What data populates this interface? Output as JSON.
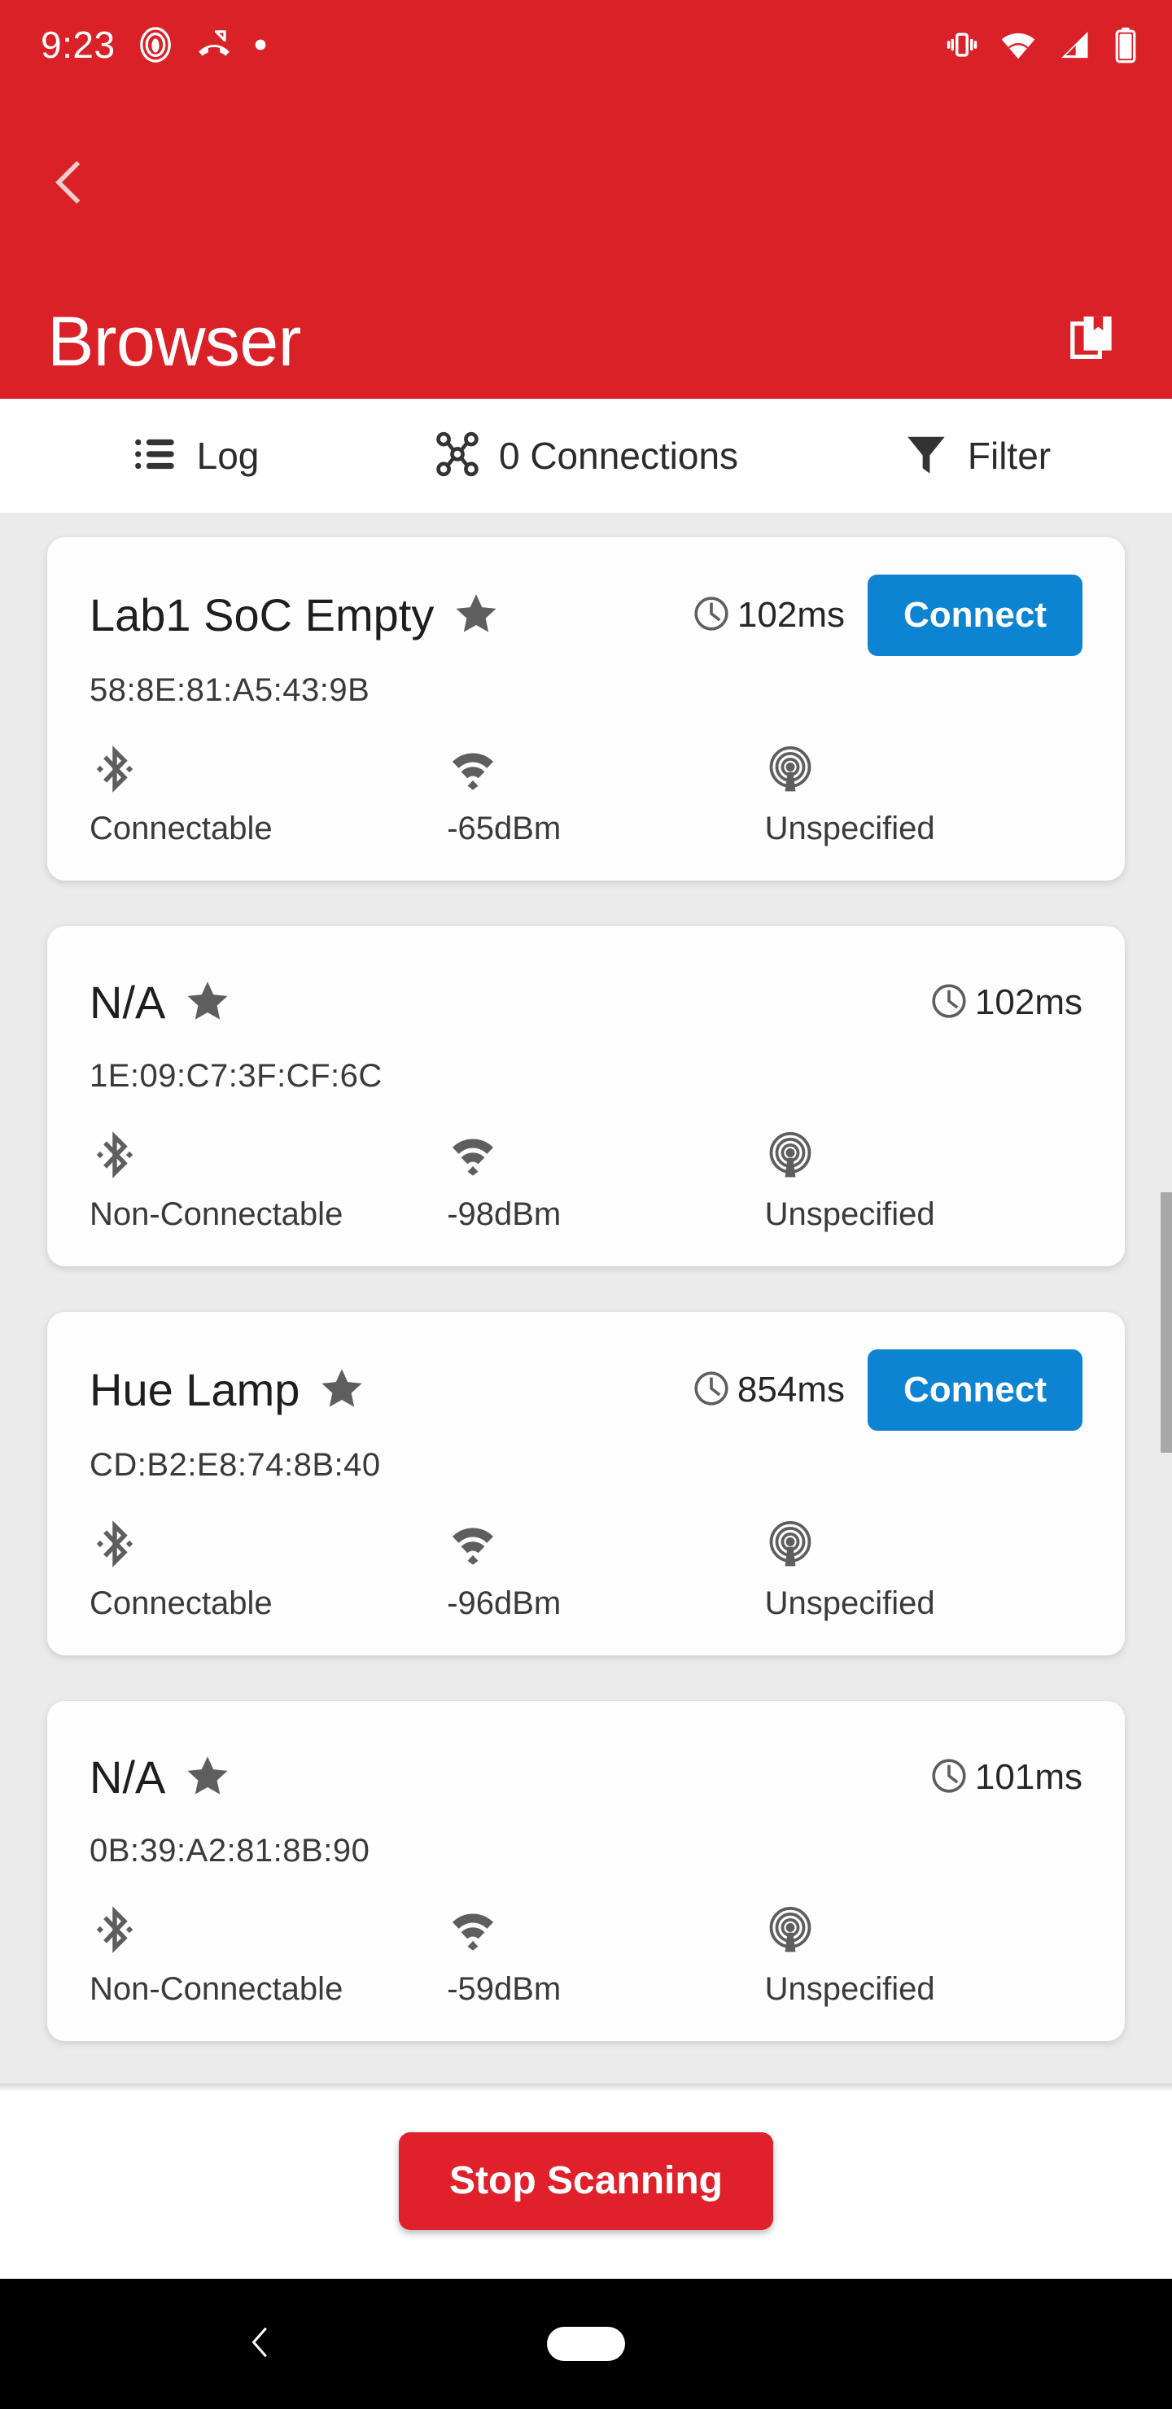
{
  "status_bar": {
    "time": "9:23",
    "left_icons": [
      "fingerprint-icon",
      "missed-call-icon",
      "dot-indicator-icon"
    ],
    "right_icons": [
      "vibrate-icon",
      "wifi-icon",
      "cellular-signal-icon",
      "battery-icon"
    ]
  },
  "app_bar": {
    "back_icon": "chevron-left-icon",
    "title": "Browser",
    "action_icon": "copy-layers-icon"
  },
  "tabs": [
    {
      "id": "log",
      "label": "Log",
      "icon": "list-icon"
    },
    {
      "id": "connections",
      "label": "0 Connections",
      "icon": "network-nodes-icon"
    },
    {
      "id": "filter",
      "label": "Filter",
      "icon": "funnel-icon"
    }
  ],
  "devices": [
    {
      "name": "Lab1 SoC Empty",
      "favorite": true,
      "latency": "102ms",
      "connectable_action": "Connect",
      "mac": "58:8E:81:A5:43:9B",
      "connectable": "Connectable",
      "rssi": "-65dBm",
      "advertising": "Unspecified"
    },
    {
      "name": "N/A",
      "favorite": true,
      "latency": "102ms",
      "connectable_action": null,
      "mac": "1E:09:C7:3F:CF:6C",
      "connectable": "Non-Connectable",
      "rssi": "-98dBm",
      "advertising": "Unspecified"
    },
    {
      "name": "Hue Lamp",
      "favorite": true,
      "latency": "854ms",
      "connectable_action": "Connect",
      "mac": "CD:B2:E8:74:8B:40",
      "connectable": "Connectable",
      "rssi": "-96dBm",
      "advertising": "Unspecified"
    },
    {
      "name": "N/A",
      "favorite": true,
      "latency": "101ms",
      "connectable_action": null,
      "mac": "0B:39:A2:81:8B:90",
      "connectable": "Non-Connectable",
      "rssi": "-59dBm",
      "advertising": "Unspecified"
    }
  ],
  "bottom": {
    "scan_button": "Stop Scanning"
  },
  "nav": {
    "back_icon": "nav-back-icon",
    "home_icon": "nav-home-pill"
  },
  "colors": {
    "brand_red": "#da2128",
    "connect_blue": "#0d84d2",
    "stop_red": "#e0202a",
    "page_bg": "#ebebeb",
    "card_bg": "#fdfdfd",
    "icon_gray": "#5e5e5e"
  }
}
